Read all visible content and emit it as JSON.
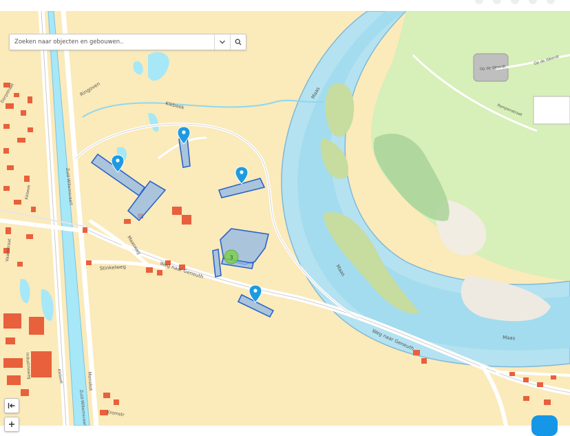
{
  "search": {
    "placeholder": "Zoeken naar objecten en gebouwen.."
  },
  "icons": {
    "dropdown": "chevron-down-icon",
    "search": "search-icon",
    "collapse": "collapse-left-icon",
    "zoom_in": "plus-icon",
    "marker": "map-pin-icon"
  },
  "map_labels": {
    "ringoven": "Ringoven",
    "kikbeek": "Kikbeek",
    "maas_top": "Maas",
    "maas_mid": "Maas",
    "maas_bottom": "Maas",
    "op_de_weerdt_1": "Op de Weerdt",
    "op_de_weerdt_2": "Op de Weerdt",
    "pompenstraat": "Pompenstraat",
    "zuid_willemsvaart": "Zuid-Willemsvaart",
    "zuid_willemsvaart_2": "Zuid-Willemsvaart",
    "maasweg": "Maasweg",
    "stinkelweg": "Stinkelweg",
    "weg_naar_geneuth_1": "Weg naar Geneuth",
    "weg_naar_geneuth_2": "Weg naar Geneuth",
    "monokot": "Monokot",
    "kromstraat": "Kromstr",
    "industrieweg": "Industrieweg",
    "vaartstraat": "Vaartstraat",
    "dorpstraat": "Dorpstraat",
    "kikbeek_2": "Kikbeek",
    "kikbeek_3": "Kikbeek"
  },
  "cluster": {
    "count": "3"
  },
  "colors": {
    "land": "#fbeaba",
    "water": "#a6e8f7",
    "river": "#b4dfed",
    "park": "#d5efb6",
    "selection": "#3b78d8",
    "marker": "#1e9be0",
    "cluster": "#7ecf54",
    "buildings": "#e8603c"
  }
}
